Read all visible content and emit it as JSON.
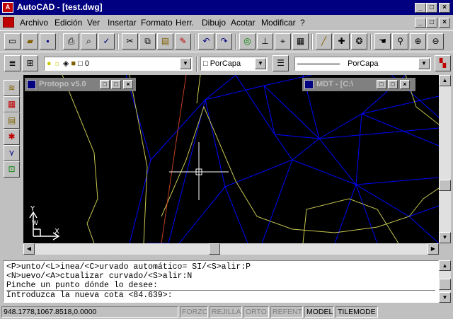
{
  "app": {
    "title": "AutoCAD - [test.dwg]",
    "icon": "autocad-icon"
  },
  "window_buttons": [
    "_",
    "□",
    "×"
  ],
  "menu": [
    "Archivo",
    "Edición",
    "Ver",
    "Insertar",
    "Formato",
    "Herr.",
    "Dibujo",
    "Acotar",
    "Modificar",
    "?"
  ],
  "layer": {
    "value": "0"
  },
  "color": {
    "value": "PorCapa"
  },
  "linetype": {
    "value": "PorCapa"
  },
  "child_windows": [
    {
      "title": "Protopo v5.0"
    },
    {
      "title": "MDT - [C:\\"
    }
  ],
  "command_lines": [
    "<P>unto/<L>inea/<C>urvado automático= SI/<S>alir:P",
    "<N>uevo/<A>ctualizar curvado/<S>alir:N",
    "Pinche un punto dónde lo desee:",
    "Introduzca la nueva cota <84.639>:"
  ],
  "status": {
    "coords": "948.1778,1067.8518,0.0000",
    "forzc": "FORZC",
    "rejilla": "REJILLA",
    "orto": "ORTO",
    "refent": "REFENT",
    "model": "MODEL",
    "tilemode": "TILEMODE"
  },
  "ucs": {
    "y": "Y",
    "w": "W",
    "x": "X"
  },
  "colors": {
    "titlebar": "#000080",
    "canvas": "#000000",
    "mesh": "#0000ff",
    "contour": "#c8c850",
    "contour_red": "#c04020"
  }
}
